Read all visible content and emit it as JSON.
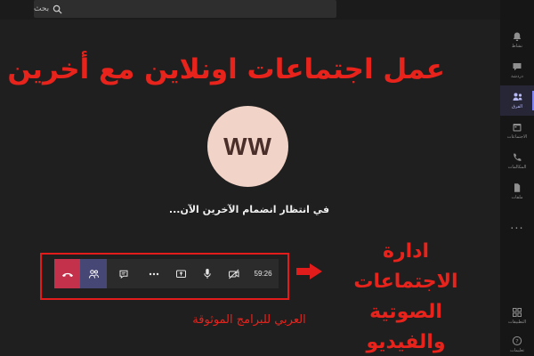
{
  "search": {
    "placeholder": "بحث",
    "icon": "search-icon"
  },
  "rail": {
    "items": [
      {
        "label": "نشاط",
        "icon": "bell-icon"
      },
      {
        "label": "دردشة",
        "icon": "chat-icon"
      },
      {
        "label": "الفرق",
        "icon": "teams-icon",
        "active": true
      },
      {
        "label": "الاجتماعات",
        "icon": "calendar-icon"
      },
      {
        "label": "المكالمات",
        "icon": "phone-icon"
      },
      {
        "label": "ملفات",
        "icon": "files-icon"
      }
    ],
    "more": "...",
    "bottom": [
      {
        "label": "التطبيقات",
        "icon": "apps-icon"
      },
      {
        "label": "تعليمات",
        "icon": "help-icon"
      }
    ]
  },
  "headline": "عمل اجتماعات اونلاين مع أخرين",
  "avatar": {
    "initials": "WW"
  },
  "waiting_text": "في انتظار انضمام الآخرين الآن...",
  "controls": {
    "timer": "59:26",
    "buttons": [
      "hangup-icon",
      "participants-icon",
      "chat-icon",
      "more-icon",
      "share-screen-icon",
      "microphone-icon",
      "camera-off-icon"
    ]
  },
  "annotation": {
    "side_line1": "ادارة الاجتماعات",
    "side_line2": "الصوتية والفيديو",
    "footer": "العربي للبرامج الموثوقة"
  },
  "colors": {
    "accent_red": "#e8231c",
    "hangup": "#c4314b",
    "people_active": "#464775",
    "rail_accent": "#7f85f5",
    "avatar_bg": "#f2d3c8"
  }
}
